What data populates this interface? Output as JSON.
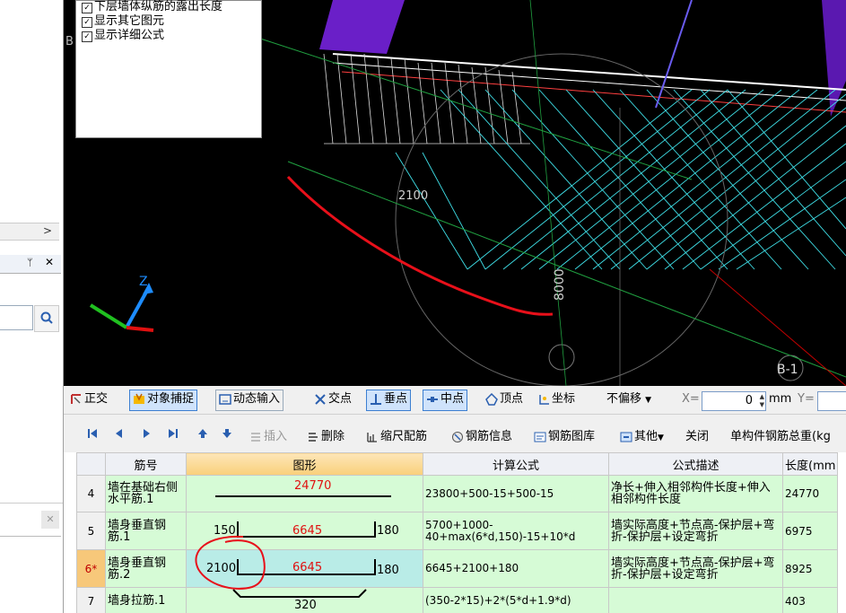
{
  "options_panel": {
    "items": [
      {
        "label": "下层墙体纵筋的露出长度",
        "checked": true
      },
      {
        "label": "显示其它图元",
        "checked": true
      },
      {
        "label": "显示详细公式",
        "checked": true
      }
    ]
  },
  "viewport": {
    "dim_2100": "2100",
    "dim_8000": "8000",
    "axis_label_b": "B",
    "axis_label_b1": "B-1",
    "axis_z": "Z"
  },
  "left_panel": {
    "scroll_arrow": ">",
    "pin": "ᛘ",
    "close": "✕",
    "lower_close": "✕"
  },
  "snap_toolbar": {
    "ortho": "正交",
    "object_snap": "对象捕捉",
    "dynamic_input": "动态输入",
    "intersection": "交点",
    "perpendicular": "垂点",
    "midpoint": "中点",
    "vertex": "顶点",
    "coordinate": "坐标",
    "offset_select": "不偏移",
    "x_label": "X=",
    "x_value": "0",
    "unit_mm": "mm",
    "y_label": "Y="
  },
  "rebar_toolbar": {
    "insert": "插入",
    "delete": "删除",
    "scale_rebar": "缩尺配筋",
    "rebar_info": "钢筋信息",
    "rebar_library": "钢筋图库",
    "other": "其他",
    "close": "关闭",
    "total_weight": "单构件钢筋总重(kg"
  },
  "table": {
    "headers": [
      "筋号",
      "图形",
      "计算公式",
      "公式描述",
      "长度(mm"
    ],
    "rows": [
      {
        "num": "4",
        "name": "墙在基础右侧水平筋.1",
        "shape_left": "",
        "shape_mid": "24770",
        "shape_right": "",
        "formula": "23800+500-15+500-15",
        "desc": "净长+伸入相邻构件长度+伸入相邻构件长度",
        "length": "24770"
      },
      {
        "num": "5",
        "name": "墙身垂直钢筋.1",
        "shape_left": "150",
        "shape_mid": "6645",
        "shape_right": "180",
        "formula": "5700+1000-40+max(6*d,150)-15+10*d",
        "desc": "墙实际高度+节点高-保护层+弯折-保护层+设定弯折",
        "length": "6975"
      },
      {
        "num": "6*",
        "name": "墙身垂直钢筋.2",
        "shape_left": "2100",
        "shape_mid": "6645",
        "shape_right": "180",
        "formula": "6645+2100+180",
        "desc": "墙实际高度+节点高-保护层+弯折-保护层+设定弯折",
        "length": "8925"
      },
      {
        "num": "7",
        "name": "墙身拉筋.1",
        "shape_left": "",
        "shape_mid": "320",
        "shape_right": "",
        "formula": "(350-2*15)+2*(5*d+1.9*d)",
        "desc": "",
        "length": "403"
      }
    ]
  },
  "colors": {
    "viewport_bg": "#000000",
    "cyan_mesh": "#3fe0e8",
    "purple_block": "#6a1fc8",
    "annotation_red": "#e8101a",
    "row_green": "#d6fbd6",
    "current_row_num": "#f7c87a"
  }
}
